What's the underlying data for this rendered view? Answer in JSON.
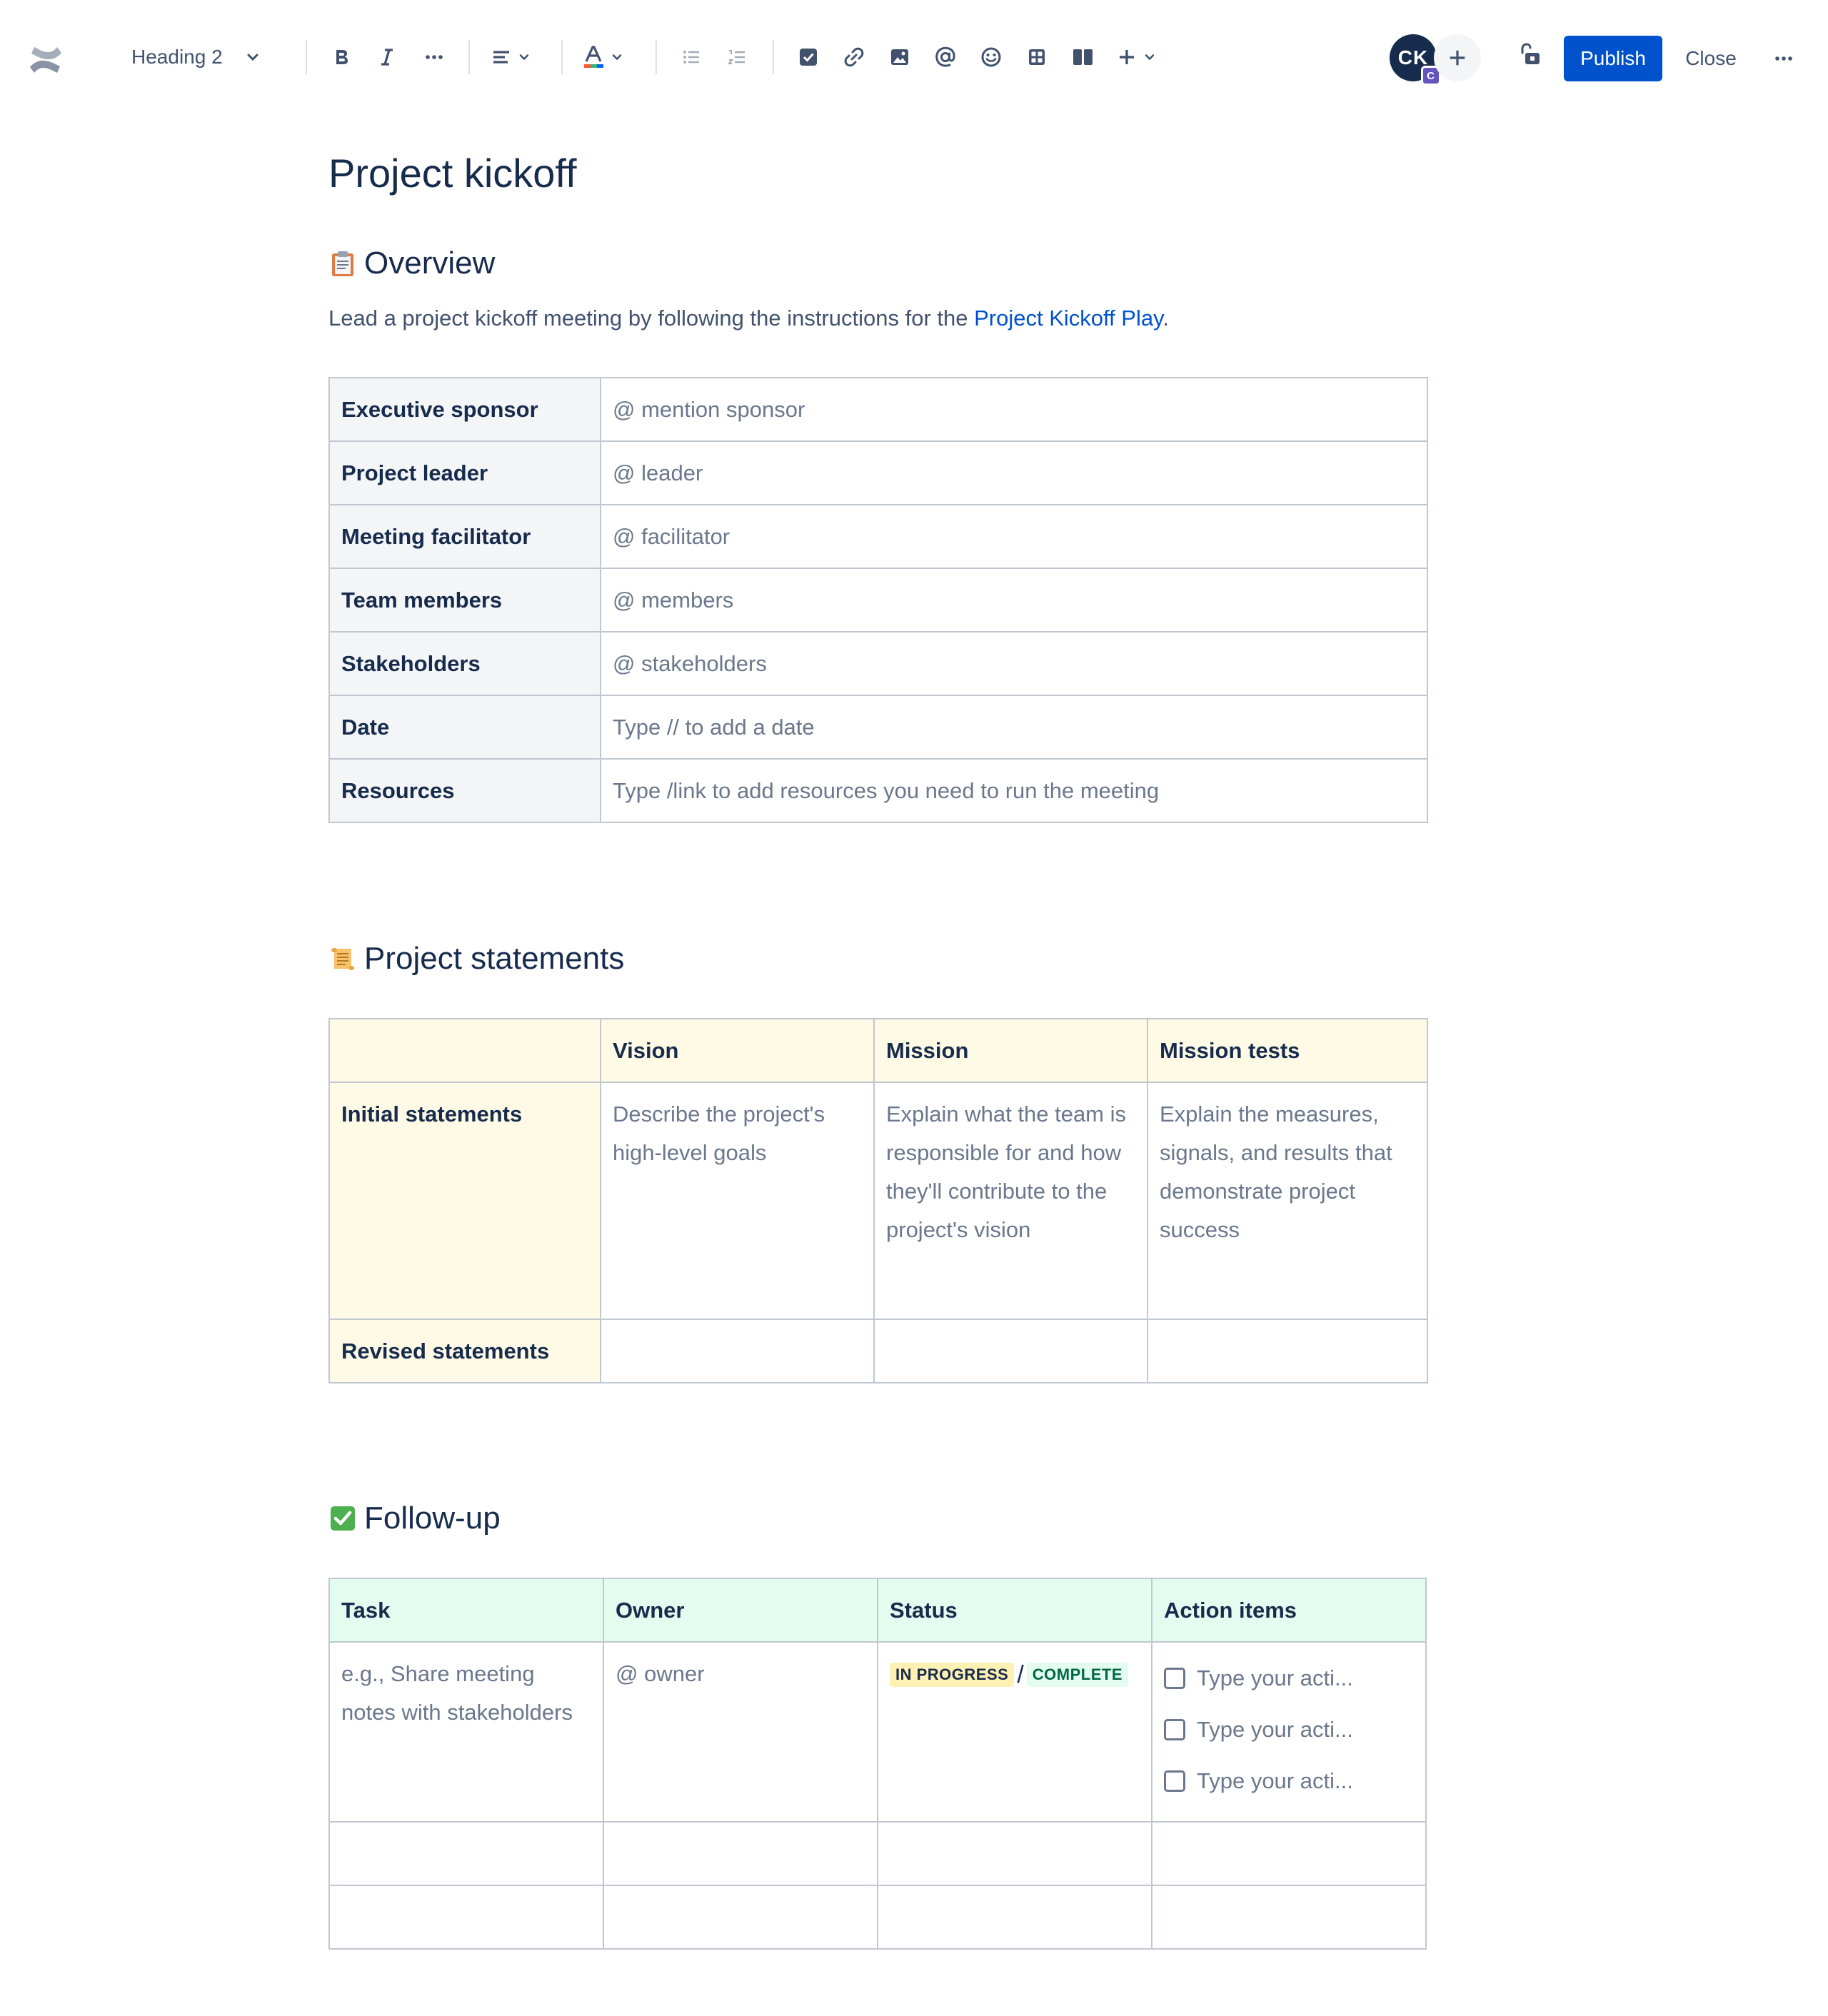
{
  "toolbar": {
    "text_style": "Heading 2",
    "publish_label": "Publish",
    "close_label": "Close",
    "avatar_initials": "CK",
    "avatar_badge": "C",
    "colors": {
      "primary": "#0052cc",
      "icon": "#42526e",
      "avatar": "#172b4d",
      "badge": "#6554c0"
    }
  },
  "page": {
    "title": "Project kickoff"
  },
  "overview": {
    "heading": "Overview",
    "emoji": "clipboard-icon",
    "intro_prefix": "Lead a project kickoff meeting by following the instructions for the ",
    "intro_link": "Project Kickoff Play",
    "intro_suffix": ".",
    "rows": [
      {
        "label": "Executive sponsor",
        "value": "@ mention sponsor"
      },
      {
        "label": "Project leader",
        "value": "@ leader"
      },
      {
        "label": "Meeting facilitator",
        "value": "@ facilitator"
      },
      {
        "label": "Team members",
        "value": "@ members"
      },
      {
        "label": "Stakeholders",
        "value": "@ stakeholders"
      },
      {
        "label": "Date",
        "value": "Type // to add a date"
      },
      {
        "label": "Resources",
        "value": "Type /link to add resources you need to run the meeting"
      }
    ]
  },
  "statements": {
    "heading": "Project statements",
    "emoji": "scroll-icon",
    "columns": [
      "",
      "Vision",
      "Mission",
      "Mission tests"
    ],
    "rows": [
      {
        "label": "Initial statements",
        "cells": [
          "Describe the project's high-level goals",
          "Explain what the team is responsible for and how they'll contribute to the project's vision",
          "Explain the measures, signals, and results that demonstrate project success"
        ]
      },
      {
        "label": "Revised statements",
        "cells": [
          "",
          "",
          ""
        ]
      }
    ]
  },
  "followup": {
    "heading": "Follow-up",
    "emoji": "check-mark-button-icon",
    "columns": [
      "Task",
      "Owner",
      "Status",
      "Action items"
    ],
    "row1": {
      "task": "e.g., Share meeting notes with stakeholders",
      "owner": "@ owner",
      "status_in_progress": "IN PROGRESS",
      "status_separator": "/",
      "status_complete": "COMPLETE",
      "action_items": [
        "Type your acti...",
        "Type your acti...",
        "Type your acti..."
      ]
    }
  }
}
